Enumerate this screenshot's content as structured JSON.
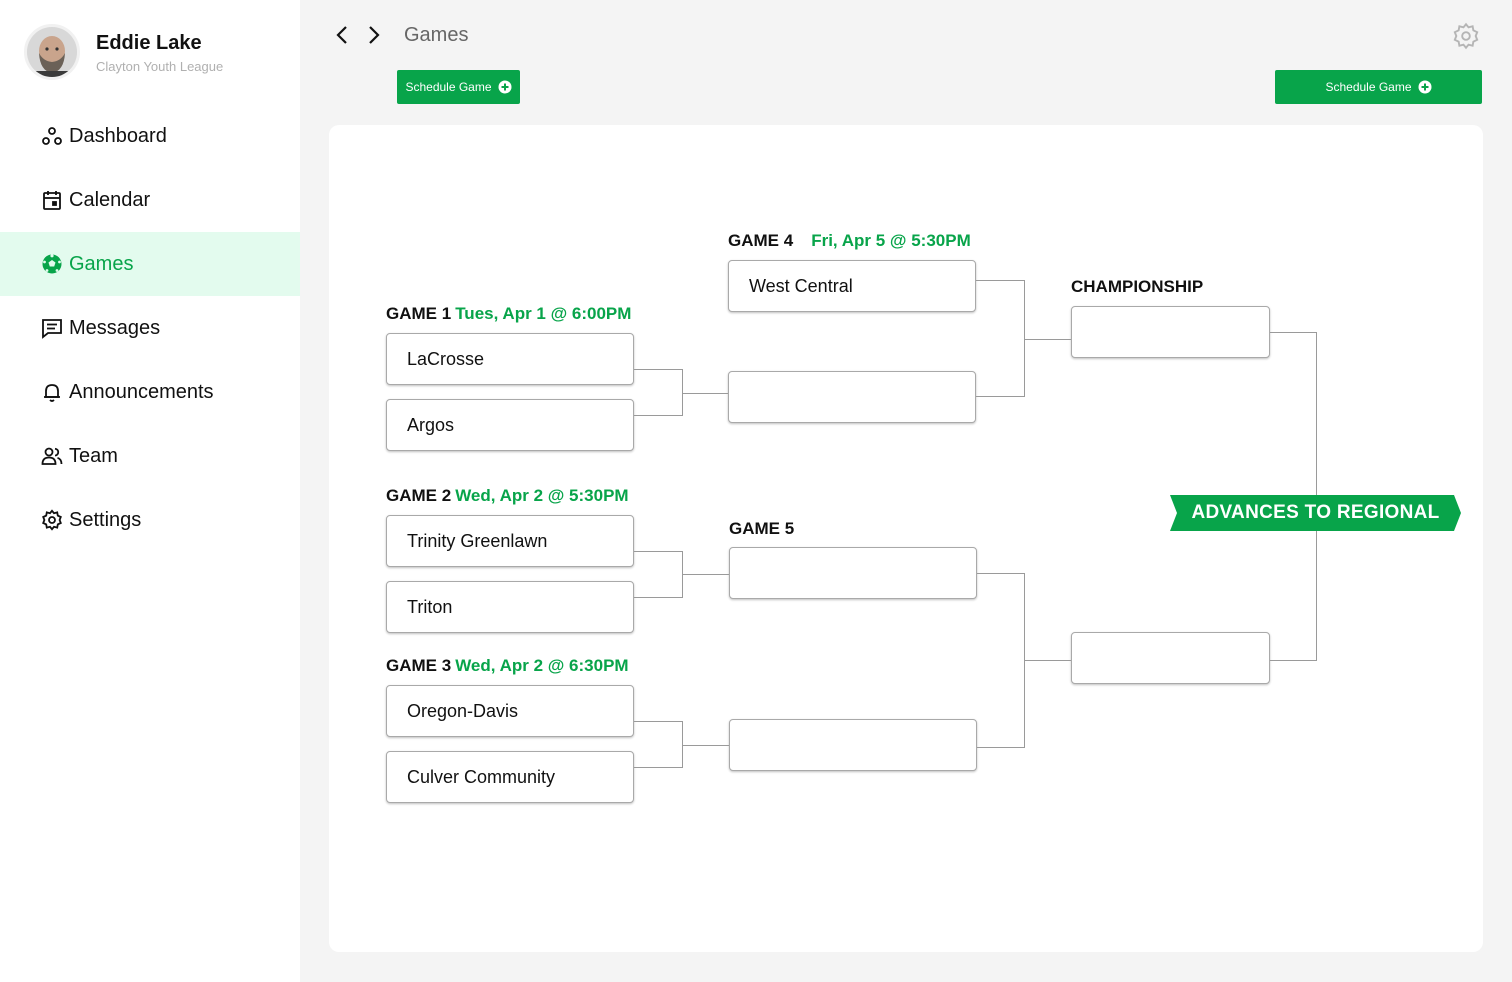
{
  "user": {
    "name": "Eddie Lake",
    "organization": "Clayton Youth League"
  },
  "nav": {
    "items": [
      {
        "label": "Dashboard",
        "icon": "dashboard-icon"
      },
      {
        "label": "Calendar",
        "icon": "calendar-icon"
      },
      {
        "label": "Games",
        "icon": "soccer-ball-icon",
        "active": true
      },
      {
        "label": "Messages",
        "icon": "messages-icon"
      },
      {
        "label": "Announcements",
        "icon": "bell-icon"
      },
      {
        "label": "Team",
        "icon": "team-icon"
      },
      {
        "label": "Settings",
        "icon": "gear-icon"
      }
    ]
  },
  "header": {
    "title": "Games",
    "schedule_label": "Schedule Game",
    "schedule_label_2": "Schedule Game"
  },
  "colors": {
    "accent": "#08a44a",
    "active_bg": "#e3fbee",
    "background": "#f4f4f4"
  },
  "bracket": {
    "game1": {
      "label": "GAME 1",
      "date": "Tues, Apr 1 @ 6:00PM",
      "team_a": "LaCrosse",
      "team_b": "Argos"
    },
    "game2": {
      "label": "GAME 2",
      "date": "Wed, Apr 2 @ 5:30PM",
      "team_a": "Trinity Greenlawn",
      "team_b": "Triton"
    },
    "game3": {
      "label": "GAME 3",
      "date": "Wed, Apr 2 @ 6:30PM",
      "team_a": "Oregon-Davis",
      "team_b": "Culver Community"
    },
    "game4": {
      "label": "GAME 4",
      "date": "Fri, Apr 5 @ 5:30PM",
      "team_a": "West Central",
      "team_b": ""
    },
    "game5": {
      "label": "GAME 5",
      "team_a": "",
      "team_b": ""
    },
    "championship": {
      "label": "CHAMPIONSHIP",
      "team_a": "",
      "team_b": ""
    },
    "banner": "ADVANCES TO REGIONAL"
  }
}
